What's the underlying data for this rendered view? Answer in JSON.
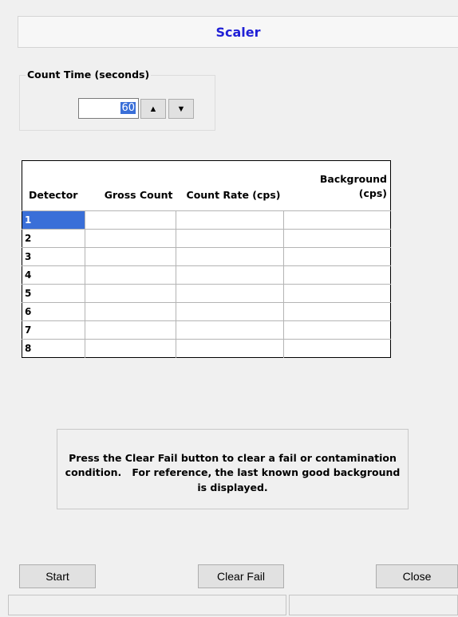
{
  "title": "Scaler",
  "count_time": {
    "label": "Count Time (seconds)",
    "value": "60"
  },
  "table": {
    "headers": [
      "Detector",
      "Gross Count",
      "Count Rate (cps)",
      "Background (cps)"
    ],
    "rows": [
      [
        "1",
        "",
        "",
        ""
      ],
      [
        "2",
        "",
        "",
        ""
      ],
      [
        "3",
        "",
        "",
        ""
      ],
      [
        "4",
        "",
        "",
        ""
      ],
      [
        "5",
        "",
        "",
        ""
      ],
      [
        "6",
        "",
        "",
        ""
      ],
      [
        "7",
        "",
        "",
        ""
      ],
      [
        "8",
        "",
        "",
        ""
      ]
    ]
  },
  "info_text": "Press the Clear Fail button to clear a fail or contamination condition.   For reference, the last known good background is displayed.",
  "buttons": {
    "start": "Start",
    "clear_fail": "Clear Fail",
    "close": "Close"
  },
  "icons": {
    "spin_up": "up-triangle",
    "spin_down": "down-triangle"
  },
  "colors": {
    "title": "#1f1fd6",
    "selection": "#3a6fd8"
  }
}
